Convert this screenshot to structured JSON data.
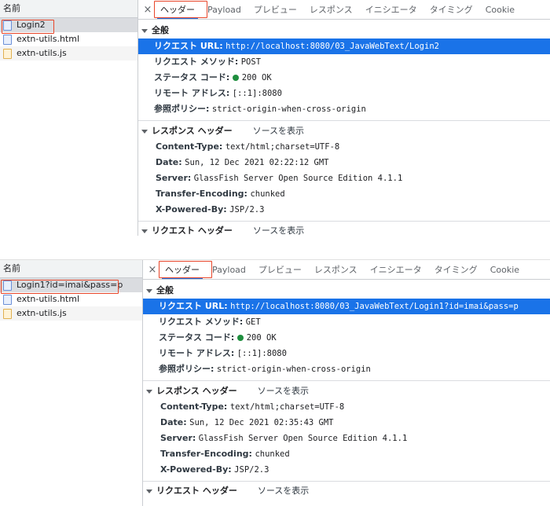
{
  "panels": [
    {
      "name_header": "名前",
      "requests": [
        {
          "name": "Login2",
          "type": "doc"
        },
        {
          "name": "extn-utils.html",
          "type": "doc"
        },
        {
          "name": "extn-utils.js",
          "type": "js"
        }
      ],
      "tabs": {
        "close": "×",
        "items": [
          "ヘッダー",
          "Payload",
          "プレビュー",
          "レスポンス",
          "イニシエータ",
          "タイミング",
          "Cookie"
        ]
      },
      "general": {
        "title": "全般",
        "url_key": "リクエスト URL:",
        "url": "http://localhost:8080/03_JavaWebText/Login2",
        "method_key": "リクエスト メソッド:",
        "method": "POST",
        "status_key": "ステータス コード:",
        "status": "200 OK",
        "remote_key": "リモート アドレス:",
        "remote": "[::1]:8080",
        "referrer_key": "参照ポリシー:",
        "referrer": "strict-origin-when-cross-origin"
      },
      "response_headers": {
        "title": "レスポンス ヘッダー",
        "view_source": "ソースを表示",
        "items": [
          {
            "k": "Content-Type:",
            "v": "text/html;charset=UTF-8"
          },
          {
            "k": "Date:",
            "v": "Sun, 12 Dec 2021 02:22:12 GMT"
          },
          {
            "k": "Server:",
            "v": "GlassFish Server Open Source Edition  4.1.1"
          },
          {
            "k": "Transfer-Encoding:",
            "v": "chunked"
          },
          {
            "k": "X-Powered-By:",
            "v": "JSP/2.3"
          }
        ]
      },
      "request_headers": {
        "title": "リクエスト ヘッダー",
        "view_source": "ソースを表示"
      }
    },
    {
      "name_header": "名前",
      "requests": [
        {
          "name": "Login1?id=imai&pass=p",
          "type": "doc"
        },
        {
          "name": "extn-utils.html",
          "type": "doc"
        },
        {
          "name": "extn-utils.js",
          "type": "js"
        }
      ],
      "tabs": {
        "close": "×",
        "items": [
          "ヘッダー",
          "Payload",
          "プレビュー",
          "レスポンス",
          "イニシエータ",
          "タイミング",
          "Cookie"
        ]
      },
      "general": {
        "title": "全般",
        "url_key": "リクエスト URL:",
        "url": "http://localhost:8080/03_JavaWebText/Login1?id=imai&pass=p",
        "method_key": "リクエスト メソッド:",
        "method": "GET",
        "status_key": "ステータス コード:",
        "status": "200 OK",
        "remote_key": "リモート アドレス:",
        "remote": "[::1]:8080",
        "referrer_key": "参照ポリシー:",
        "referrer": "strict-origin-when-cross-origin"
      },
      "response_headers": {
        "title": "レスポンス ヘッダー",
        "view_source": "ソースを表示",
        "items": [
          {
            "k": "Content-Type:",
            "v": "text/html;charset=UTF-8"
          },
          {
            "k": "Date:",
            "v": "Sun, 12 Dec 2021 02:35:43 GMT"
          },
          {
            "k": "Server:",
            "v": "GlassFish Server Open Source Edition  4.1.1"
          },
          {
            "k": "Transfer-Encoding:",
            "v": "chunked"
          },
          {
            "k": "X-Powered-By:",
            "v": "JSP/2.3"
          }
        ]
      },
      "request_headers": {
        "title": "リクエスト ヘッダー",
        "view_source": "ソースを表示"
      }
    }
  ],
  "colors": {
    "highlight": "#1a73e8",
    "annotation": "#e8462a",
    "status_ok": "#1e8e3e"
  }
}
